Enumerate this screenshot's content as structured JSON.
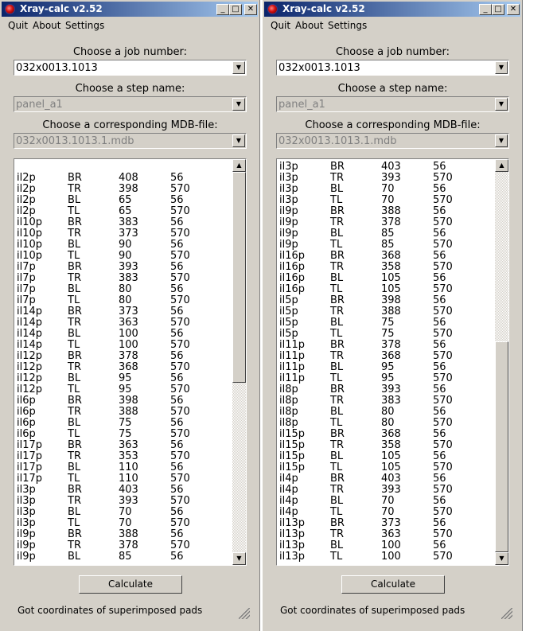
{
  "windows": [
    {
      "title": "Xray-calc v2.52",
      "title_buttons": {
        "minimize": "_",
        "maximize": "□",
        "close": "✕"
      },
      "menu": [
        "Quit",
        "About",
        "Settings"
      ],
      "job_label": "Choose a job number:",
      "job_value": "032x0013.1013",
      "step_label": "Choose a step name:",
      "step_value": "panel_a1",
      "mdb_label": "Choose a corresponding MDB-file:",
      "mdb_value": "032x0013.1013.1.mdb",
      "scroll_position": 0.0,
      "rows": [
        [
          "il2p",
          "BR",
          "408",
          "56"
        ],
        [
          "il2p",
          "TR",
          "398",
          "570"
        ],
        [
          "il2p",
          "BL",
          "65",
          "56"
        ],
        [
          "il2p",
          "TL",
          "65",
          "570"
        ],
        [
          "il10p",
          "BR",
          "383",
          "56"
        ],
        [
          "il10p",
          "TR",
          "373",
          "570"
        ],
        [
          "il10p",
          "BL",
          "90",
          "56"
        ],
        [
          "il10p",
          "TL",
          "90",
          "570"
        ],
        [
          "il7p",
          "BR",
          "393",
          "56"
        ],
        [
          "il7p",
          "TR",
          "383",
          "570"
        ],
        [
          "il7p",
          "BL",
          "80",
          "56"
        ],
        [
          "il7p",
          "TL",
          "80",
          "570"
        ],
        [
          "il14p",
          "BR",
          "373",
          "56"
        ],
        [
          "il14p",
          "TR",
          "363",
          "570"
        ],
        [
          "il14p",
          "BL",
          "100",
          "56"
        ],
        [
          "il14p",
          "TL",
          "100",
          "570"
        ],
        [
          "il12p",
          "BR",
          "378",
          "56"
        ],
        [
          "il12p",
          "TR",
          "368",
          "570"
        ],
        [
          "il12p",
          "BL",
          "95",
          "56"
        ],
        [
          "il12p",
          "TL",
          "95",
          "570"
        ],
        [
          "il6p",
          "BR",
          "398",
          "56"
        ],
        [
          "il6p",
          "TR",
          "388",
          "570"
        ],
        [
          "il6p",
          "BL",
          "75",
          "56"
        ],
        [
          "il6p",
          "TL",
          "75",
          "570"
        ],
        [
          "il17p",
          "BR",
          "363",
          "56"
        ],
        [
          "il17p",
          "TR",
          "353",
          "570"
        ],
        [
          "il17p",
          "BL",
          "110",
          "56"
        ],
        [
          "il17p",
          "TL",
          "110",
          "570"
        ],
        [
          "il3p",
          "BR",
          "403",
          "56"
        ],
        [
          "il3p",
          "TR",
          "393",
          "570"
        ],
        [
          "il3p",
          "BL",
          "70",
          "56"
        ],
        [
          "il3p",
          "TL",
          "70",
          "570"
        ],
        [
          "il9p",
          "BR",
          "388",
          "56"
        ],
        [
          "il9p",
          "TR",
          "378",
          "570"
        ],
        [
          "il9p",
          "BL",
          "85",
          "56"
        ]
      ],
      "calculate_label": "Calculate",
      "status": "Got coordinates of superimposed pads"
    },
    {
      "title": "Xray-calc v2.52",
      "title_buttons": {
        "minimize": "_",
        "maximize": "□",
        "close": "✕"
      },
      "menu": [
        "Quit",
        "About",
        "Settings"
      ],
      "job_label": "Choose a job number:",
      "job_value": "032x0013.1013",
      "step_label": "Choose a step name:",
      "step_value": "panel_a1",
      "mdb_label": "Choose a corresponding MDB-file:",
      "mdb_value": "032x0013.1013.1.mdb",
      "scroll_position": 1.0,
      "rows": [
        [
          "il3p",
          "BR",
          "403",
          "56"
        ],
        [
          "il3p",
          "TR",
          "393",
          "570"
        ],
        [
          "il3p",
          "BL",
          "70",
          "56"
        ],
        [
          "il3p",
          "TL",
          "70",
          "570"
        ],
        [
          "il9p",
          "BR",
          "388",
          "56"
        ],
        [
          "il9p",
          "TR",
          "378",
          "570"
        ],
        [
          "il9p",
          "BL",
          "85",
          "56"
        ],
        [
          "il9p",
          "TL",
          "85",
          "570"
        ],
        [
          "il16p",
          "BR",
          "368",
          "56"
        ],
        [
          "il16p",
          "TR",
          "358",
          "570"
        ],
        [
          "il16p",
          "BL",
          "105",
          "56"
        ],
        [
          "il16p",
          "TL",
          "105",
          "570"
        ],
        [
          "il5p",
          "BR",
          "398",
          "56"
        ],
        [
          "il5p",
          "TR",
          "388",
          "570"
        ],
        [
          "il5p",
          "BL",
          "75",
          "56"
        ],
        [
          "il5p",
          "TL",
          "75",
          "570"
        ],
        [
          "il11p",
          "BR",
          "378",
          "56"
        ],
        [
          "il11p",
          "TR",
          "368",
          "570"
        ],
        [
          "il11p",
          "BL",
          "95",
          "56"
        ],
        [
          "il11p",
          "TL",
          "95",
          "570"
        ],
        [
          "il8p",
          "BR",
          "393",
          "56"
        ],
        [
          "il8p",
          "TR",
          "383",
          "570"
        ],
        [
          "il8p",
          "BL",
          "80",
          "56"
        ],
        [
          "il8p",
          "TL",
          "80",
          "570"
        ],
        [
          "il15p",
          "BR",
          "368",
          "56"
        ],
        [
          "il15p",
          "TR",
          "358",
          "570"
        ],
        [
          "il15p",
          "BL",
          "105",
          "56"
        ],
        [
          "il15p",
          "TL",
          "105",
          "570"
        ],
        [
          "il4p",
          "BR",
          "403",
          "56"
        ],
        [
          "il4p",
          "TR",
          "393",
          "570"
        ],
        [
          "il4p",
          "BL",
          "70",
          "56"
        ],
        [
          "il4p",
          "TL",
          "70",
          "570"
        ],
        [
          "il13p",
          "BR",
          "373",
          "56"
        ],
        [
          "il13p",
          "TR",
          "363",
          "570"
        ],
        [
          "il13p",
          "BL",
          "100",
          "56"
        ],
        [
          "il13p",
          "TL",
          "100",
          "570"
        ]
      ],
      "calculate_label": "Calculate",
      "status": "Got coordinates of superimposed pads"
    }
  ]
}
